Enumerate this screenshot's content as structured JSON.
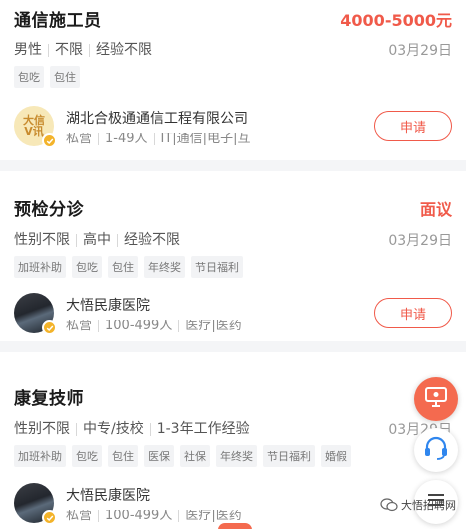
{
  "colors": {
    "accent": "#f05a4a",
    "verify": "#f3b32a",
    "float_accent": "#f46a4f"
  },
  "jobs": [
    {
      "title": "通信施工员",
      "salary": "4000-5000元",
      "requirements": [
        "男性",
        "不限",
        "经验不限"
      ],
      "date": "03月29日",
      "tags": [
        "包吃",
        "包住"
      ],
      "company": {
        "logo_text": "大信 V讯",
        "name": "湖北合极通通信工程有限公司",
        "meta": [
          "私营",
          "1-49人",
          "IT|通信|电子|互"
        ]
      },
      "apply_label": "申请"
    },
    {
      "title": "预检分诊",
      "salary": "面议",
      "requirements": [
        "性别不限",
        "高中",
        "经验不限"
      ],
      "date": "03月29日",
      "tags": [
        "加班补助",
        "包吃",
        "包住",
        "年终奖",
        "节日福利"
      ],
      "company": {
        "name": "大悟民康医院",
        "meta": [
          "私营",
          "100-499人",
          "医疗|医药"
        ]
      },
      "apply_label": "申请"
    },
    {
      "title": "康复技师",
      "salary": "",
      "requirements": [
        "性别不限",
        "中专/技校",
        "1-3年工作经验"
      ],
      "date": "03月29日",
      "tags": [
        "加班补助",
        "包吃",
        "包住",
        "医保",
        "社保",
        "年终奖",
        "节日福利",
        "婚假"
      ],
      "company": {
        "name": "大悟民康医院",
        "meta": [
          "私营",
          "100-499人",
          "医疗|医药"
        ]
      },
      "apply_label": ""
    }
  ],
  "floating_buttons": [
    {
      "icon": "screen-icon"
    },
    {
      "icon": "headset-icon"
    },
    {
      "icon": "menu-icon"
    }
  ],
  "watermark": {
    "text": "大悟招聘网"
  }
}
